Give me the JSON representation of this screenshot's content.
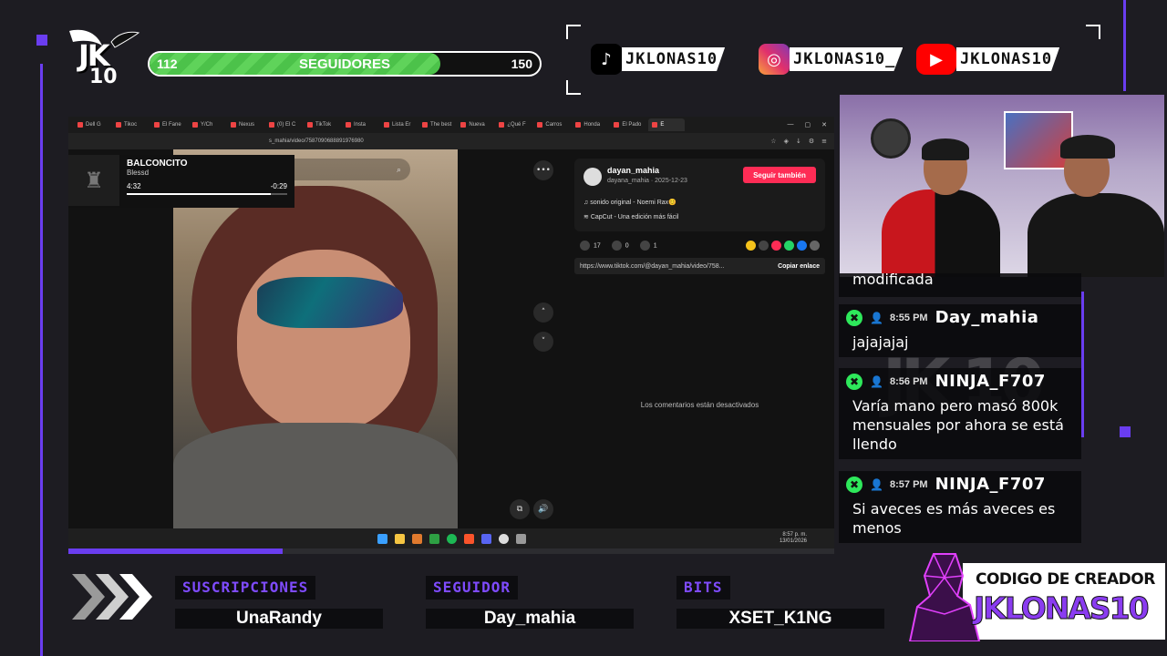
{
  "colors": {
    "accent": "#6a3df0",
    "progress_green": "#5fd35a",
    "chat_icon": "#2ee85b",
    "tiktok_red": "#fe2c55"
  },
  "followers": {
    "current": "112",
    "label": "SEGUIDORES",
    "goal": "150",
    "progress": 0.746
  },
  "logo": {
    "top": "JK",
    "bottom": "10"
  },
  "socials": [
    {
      "icon": "tiktok-icon",
      "handle": "JKLONAS10"
    },
    {
      "icon": "instagram-icon",
      "handle": "JKLONAS10_"
    },
    {
      "icon": "youtube-icon",
      "handle": "JKLONAS10"
    }
  ],
  "browser": {
    "tabs": [
      "Dell G",
      "Tikoc",
      "El Fane",
      "Y/Ch",
      "Nexus",
      "(0) El C",
      "TikTok",
      "Insta",
      "Lista Er",
      "The best",
      "Nueva",
      "¿Qué F",
      "Carros",
      "Honda",
      "El Pado",
      "E"
    ],
    "active_tab_index": 15,
    "url": "s_mahia/video/7587090688891976980",
    "search_placeholder": "lacionado"
  },
  "media": {
    "title": "BALCONCITO",
    "artist": "Blessd",
    "elapsed": "4:32",
    "remaining": "-0:29",
    "progress": 0.9
  },
  "tiktok": {
    "username": "dayan_mahia",
    "subline": "dayana_mahia · 2025-12-23",
    "follow_button": "Seguir también",
    "sound": "sonido original - Noemi Rax😊",
    "capcut": "CapCut - Una edición más fácil",
    "likes": "17",
    "comments": "0",
    "saves": "1",
    "link": "https://www.tiktok.com/@dayan_mahia/video/758...",
    "copy_link": "Copiar enlace",
    "comments_off": "Los comentarios están desactivados"
  },
  "taskbar": {
    "time": "8:57 p. m.",
    "date": "13/01/2026"
  },
  "stream_progress": 0.28,
  "chat": [
    {
      "partial": true,
      "text": "modificada"
    },
    {
      "time": "8:55 PM",
      "user": "Day_mahia",
      "text": "jajajajaj"
    },
    {
      "time": "8:56 PM",
      "user": "NINJA_F707",
      "text": "Varía mano pero masó 800k mensuales por ahora se está llendo"
    },
    {
      "time": "8:57 PM",
      "user": "NINJA_F707",
      "text": "Si aveces es más aveces es menos"
    }
  ],
  "watermark": "JK 10",
  "bottom": {
    "subs": {
      "label": "SUSCRIPCIONES",
      "value": "UnaRandy"
    },
    "follower": {
      "label": "SEGUIDOR",
      "value": "Day_mahia"
    },
    "bits": {
      "label": "BITS",
      "value": "XSET_K1NG"
    }
  },
  "creator": {
    "line1": "CODIGO DE CREADOR",
    "line2": "JKLONAS10"
  }
}
